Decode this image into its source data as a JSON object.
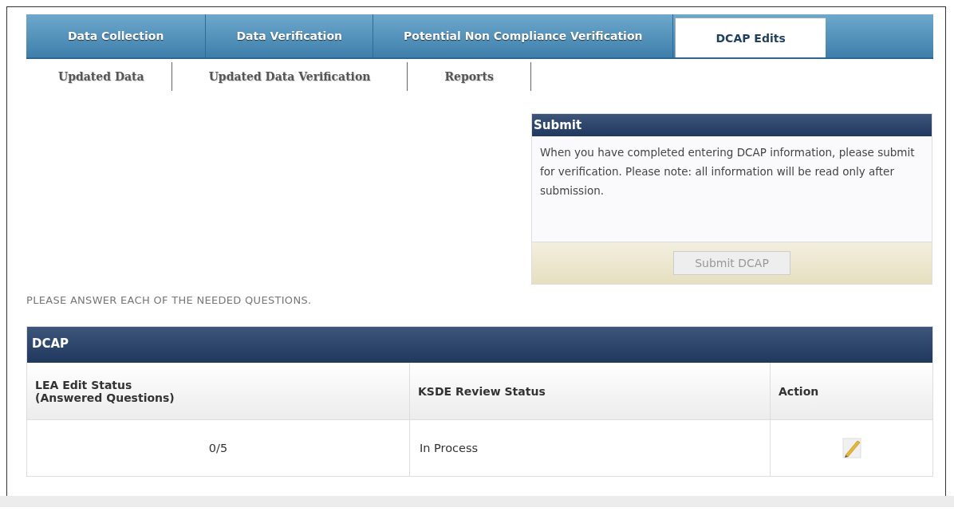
{
  "tabs": [
    {
      "label": "Data Collection",
      "selected": false
    },
    {
      "label": "Data Verification",
      "selected": false
    },
    {
      "label": "Potential Non Compliance Verification",
      "selected": false
    },
    {
      "label": "DCAP Edits",
      "selected": true
    }
  ],
  "subtabs": [
    {
      "label": "Updated Data"
    },
    {
      "label": "Updated Data Verification"
    },
    {
      "label": "Reports"
    }
  ],
  "submit_panel": {
    "title": "Submit",
    "message": "When you have completed entering DCAP information, please submit for verification. Please note: all information will be read only after submission.",
    "button": {
      "label": "Submit DCAP",
      "disabled": true
    }
  },
  "instruction": "PLEASE ANSWER EACH OF THE NEEDED QUESTIONS.",
  "table": {
    "title": "DCAP",
    "columns": [
      "LEA Edit Status\n(Answered Questions)",
      "KSDE Review Status",
      "Action"
    ],
    "rows": [
      {
        "answered": "0/5",
        "review_status": "In Process",
        "editable": true
      }
    ]
  }
}
